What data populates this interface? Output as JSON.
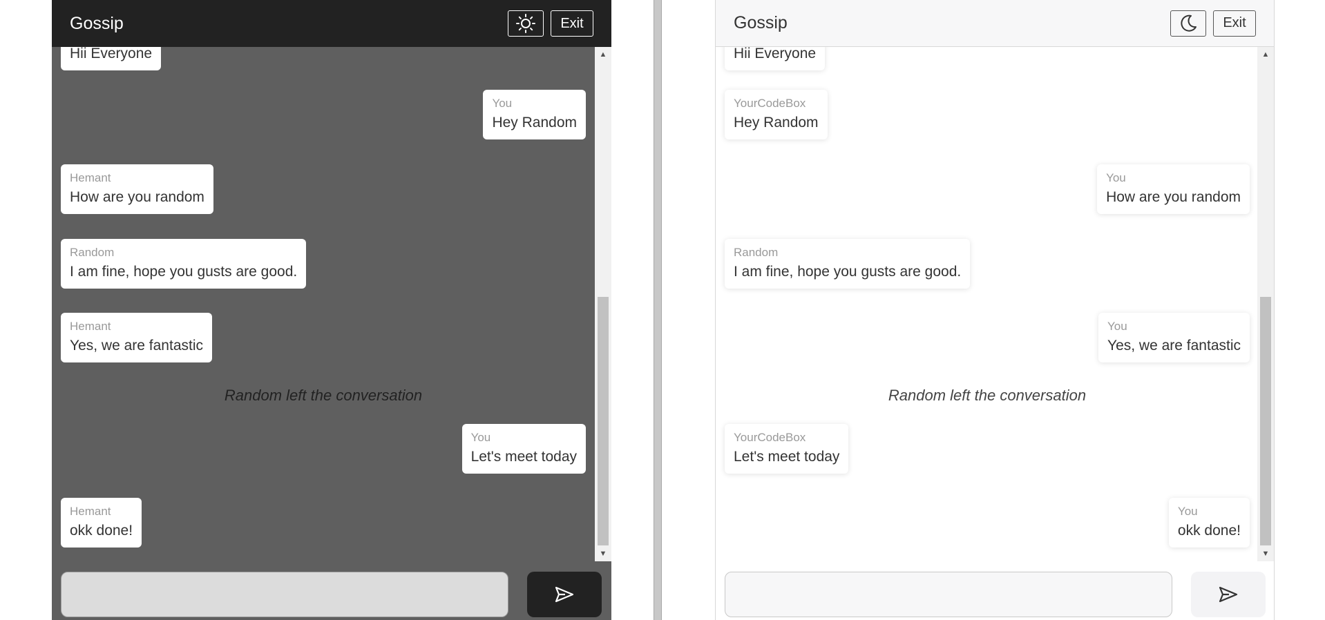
{
  "dark_panel": {
    "title": "Gossip",
    "theme_icon": "sun-icon",
    "exit_label": "Exit",
    "messages": [
      {
        "type": "message",
        "side": "left",
        "sender": "",
        "text": "Hii Everyone"
      },
      {
        "type": "message",
        "side": "right",
        "sender": "You",
        "text": "Hey Random"
      },
      {
        "type": "message",
        "side": "left",
        "sender": "Hemant",
        "text": "How are you random"
      },
      {
        "type": "message",
        "side": "left",
        "sender": "Random",
        "text": "I am fine, hope you gusts are good."
      },
      {
        "type": "message",
        "side": "left",
        "sender": "Hemant",
        "text": "Yes, we are fantastic"
      },
      {
        "type": "notice",
        "text": "Random left the conversation"
      },
      {
        "type": "message",
        "side": "right",
        "sender": "You",
        "text": "Let's meet today"
      },
      {
        "type": "message",
        "side": "left",
        "sender": "Hemant",
        "text": "okk done!"
      }
    ],
    "input_value": "",
    "send_icon": "send-icon"
  },
  "light_panel": {
    "title": "Gossip",
    "theme_icon": "moon-icon",
    "exit_label": "Exit",
    "messages": [
      {
        "type": "message",
        "side": "left",
        "sender": "",
        "text": "Hii Everyone"
      },
      {
        "type": "message",
        "side": "left",
        "sender": "YourCodeBox",
        "text": "Hey Random"
      },
      {
        "type": "message",
        "side": "right",
        "sender": "You",
        "text": "How are you random"
      },
      {
        "type": "message",
        "side": "left",
        "sender": "Random",
        "text": "I am fine, hope you gusts are good."
      },
      {
        "type": "message",
        "side": "right",
        "sender": "You",
        "text": "Yes, we are fantastic"
      },
      {
        "type": "notice",
        "text": "Random left the conversation"
      },
      {
        "type": "message",
        "side": "left",
        "sender": "YourCodeBox",
        "text": "Let's meet today"
      },
      {
        "type": "message",
        "side": "right",
        "sender": "You",
        "text": "okk done!"
      }
    ],
    "input_value": "",
    "send_icon": "send-icon"
  }
}
